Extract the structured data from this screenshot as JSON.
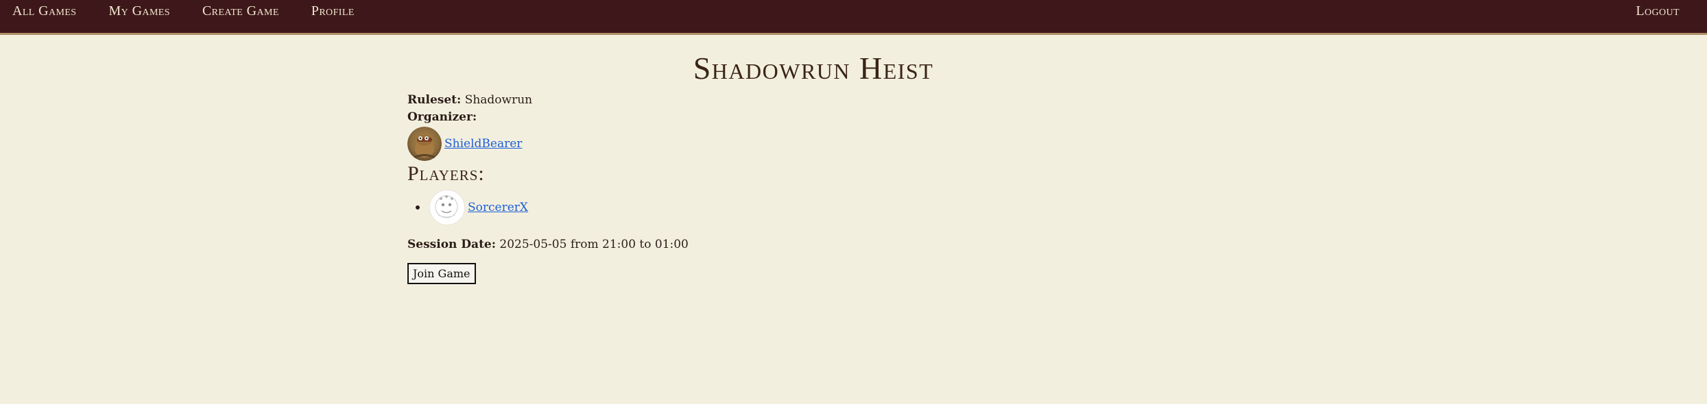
{
  "nav": {
    "items": [
      {
        "label": "All Games"
      },
      {
        "label": "My Games"
      },
      {
        "label": "Create Game"
      },
      {
        "label": "Profile"
      }
    ],
    "logout": "Logout"
  },
  "game": {
    "title": "Shadowrun Heist",
    "ruleset_label": "Ruleset:",
    "ruleset_value": "Shadowrun",
    "organizer_label": "Organizer:",
    "organizer_name": "ShieldBearer",
    "players_heading": "Players:",
    "players": [
      {
        "name": "SorcererX"
      }
    ],
    "session_label": "Session Date:",
    "session_value": "2025-05-05 from 21:00 to 01:00",
    "join_label": "Join Game"
  },
  "colors": {
    "topbar": "#3d1719",
    "background": "#f3efdf",
    "link": "#1b5fd6",
    "accent_border": "#b08f68"
  }
}
